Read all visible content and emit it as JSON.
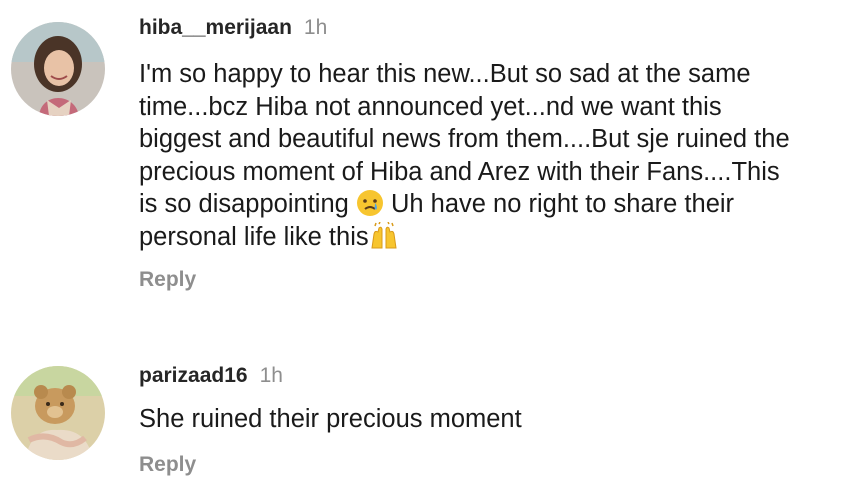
{
  "comments": [
    {
      "username": "hiba__merijaan",
      "time": "1h",
      "lines": [
        "I'm so happy to hear this new...But so sad at the same",
        "time...bcz Hiba not announced yet...nd we want this",
        "biggest and beautiful news from them....But sje ruined the",
        "precious moment of Hiba and Arez with their Fans....This",
        "is so disappointing",
        "Uh have no right to share their",
        "personal life like this"
      ],
      "emojis": [
        "crying-face-emoji",
        "raising-hands-emoji"
      ],
      "reply_label": "Reply"
    },
    {
      "username": "parizaad16",
      "time": "1h",
      "lines": [
        "She ruined their precious moment"
      ],
      "reply_label": "Reply"
    }
  ]
}
